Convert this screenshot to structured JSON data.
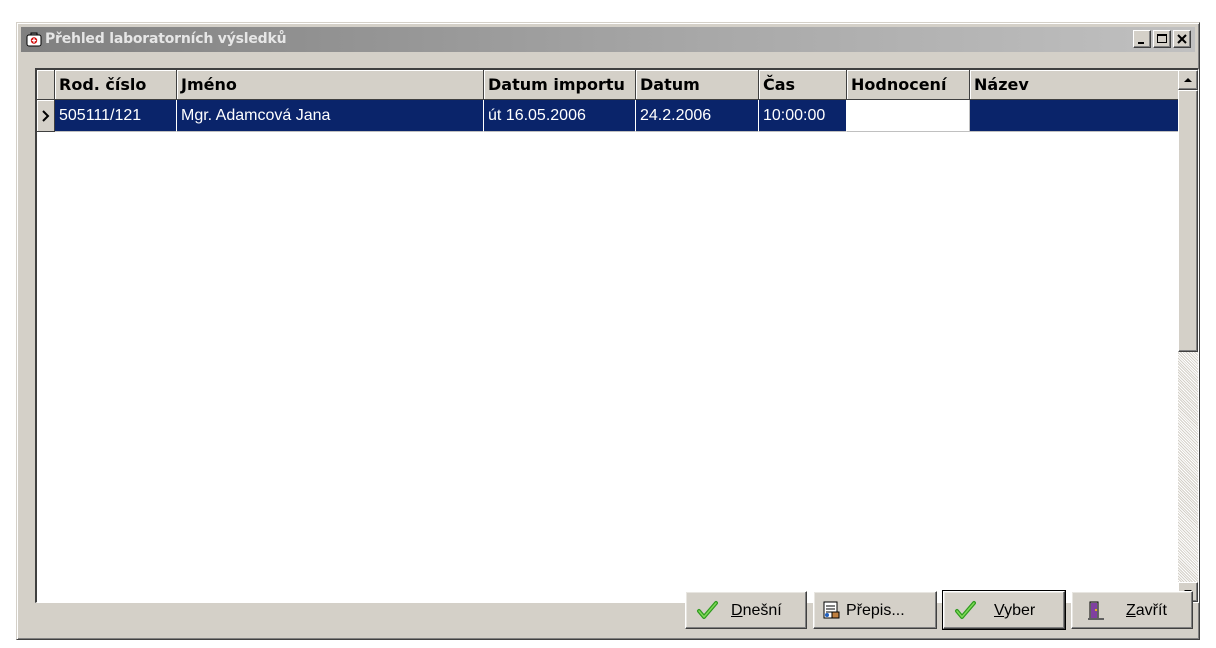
{
  "window": {
    "title": "Přehled laboratorních výsledků",
    "controls": [
      "minimize",
      "maximize",
      "close"
    ]
  },
  "grid": {
    "columns": [
      "Rod. číslo",
      "Jméno",
      "Datum importu",
      "Datum",
      "Čas",
      "Hodnocení",
      "Název"
    ],
    "rows": [
      {
        "rod_cislo": "505111/121",
        "jmeno": "Mgr. Adamcová Jana",
        "datum_importu": "út 16.05.2006",
        "datum": "24.2.2006",
        "cas": "10:00:00",
        "hodnoceni": "",
        "nazev": ""
      }
    ],
    "selection_color": "#0a246a"
  },
  "buttons": {
    "dnesni": {
      "underline": "D",
      "rest": "nešní",
      "icon": "green-check-icon"
    },
    "prepis": {
      "label": "Přepis...",
      "icon": "document-icon"
    },
    "vyber": {
      "underline": "V",
      "rest": "yber",
      "icon": "check-icon"
    },
    "zavrit": {
      "underline": "Z",
      "rest": "avřít",
      "icon": "exit-door-icon"
    }
  }
}
